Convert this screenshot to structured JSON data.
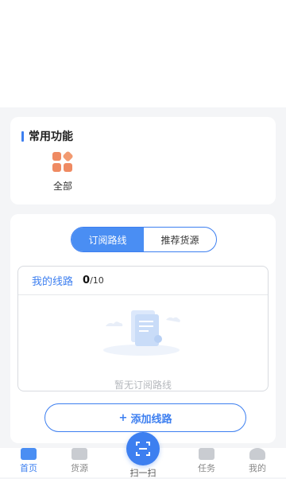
{
  "common_functions": {
    "title": "常用功能",
    "items": [
      {
        "label": "全部",
        "icon": "grid-icon"
      }
    ]
  },
  "routes": {
    "tabs": [
      {
        "label": "订阅路线",
        "active": true
      },
      {
        "label": "推荐货源",
        "active": false
      }
    ],
    "my_routes_label": "我的线路",
    "count_current": "0",
    "count_total": "/10",
    "empty_text": "暂无订阅路线",
    "add_button_plus": "+",
    "add_button_label": "添加线路"
  },
  "tabbar": {
    "home": "首页",
    "cargo": "货源",
    "scan": "扫一扫",
    "task": "任务",
    "mine": "我的"
  },
  "colors": {
    "accent": "#3d7ff0",
    "icon_orange": "#ef8a62",
    "background": "#f4f5f7"
  }
}
